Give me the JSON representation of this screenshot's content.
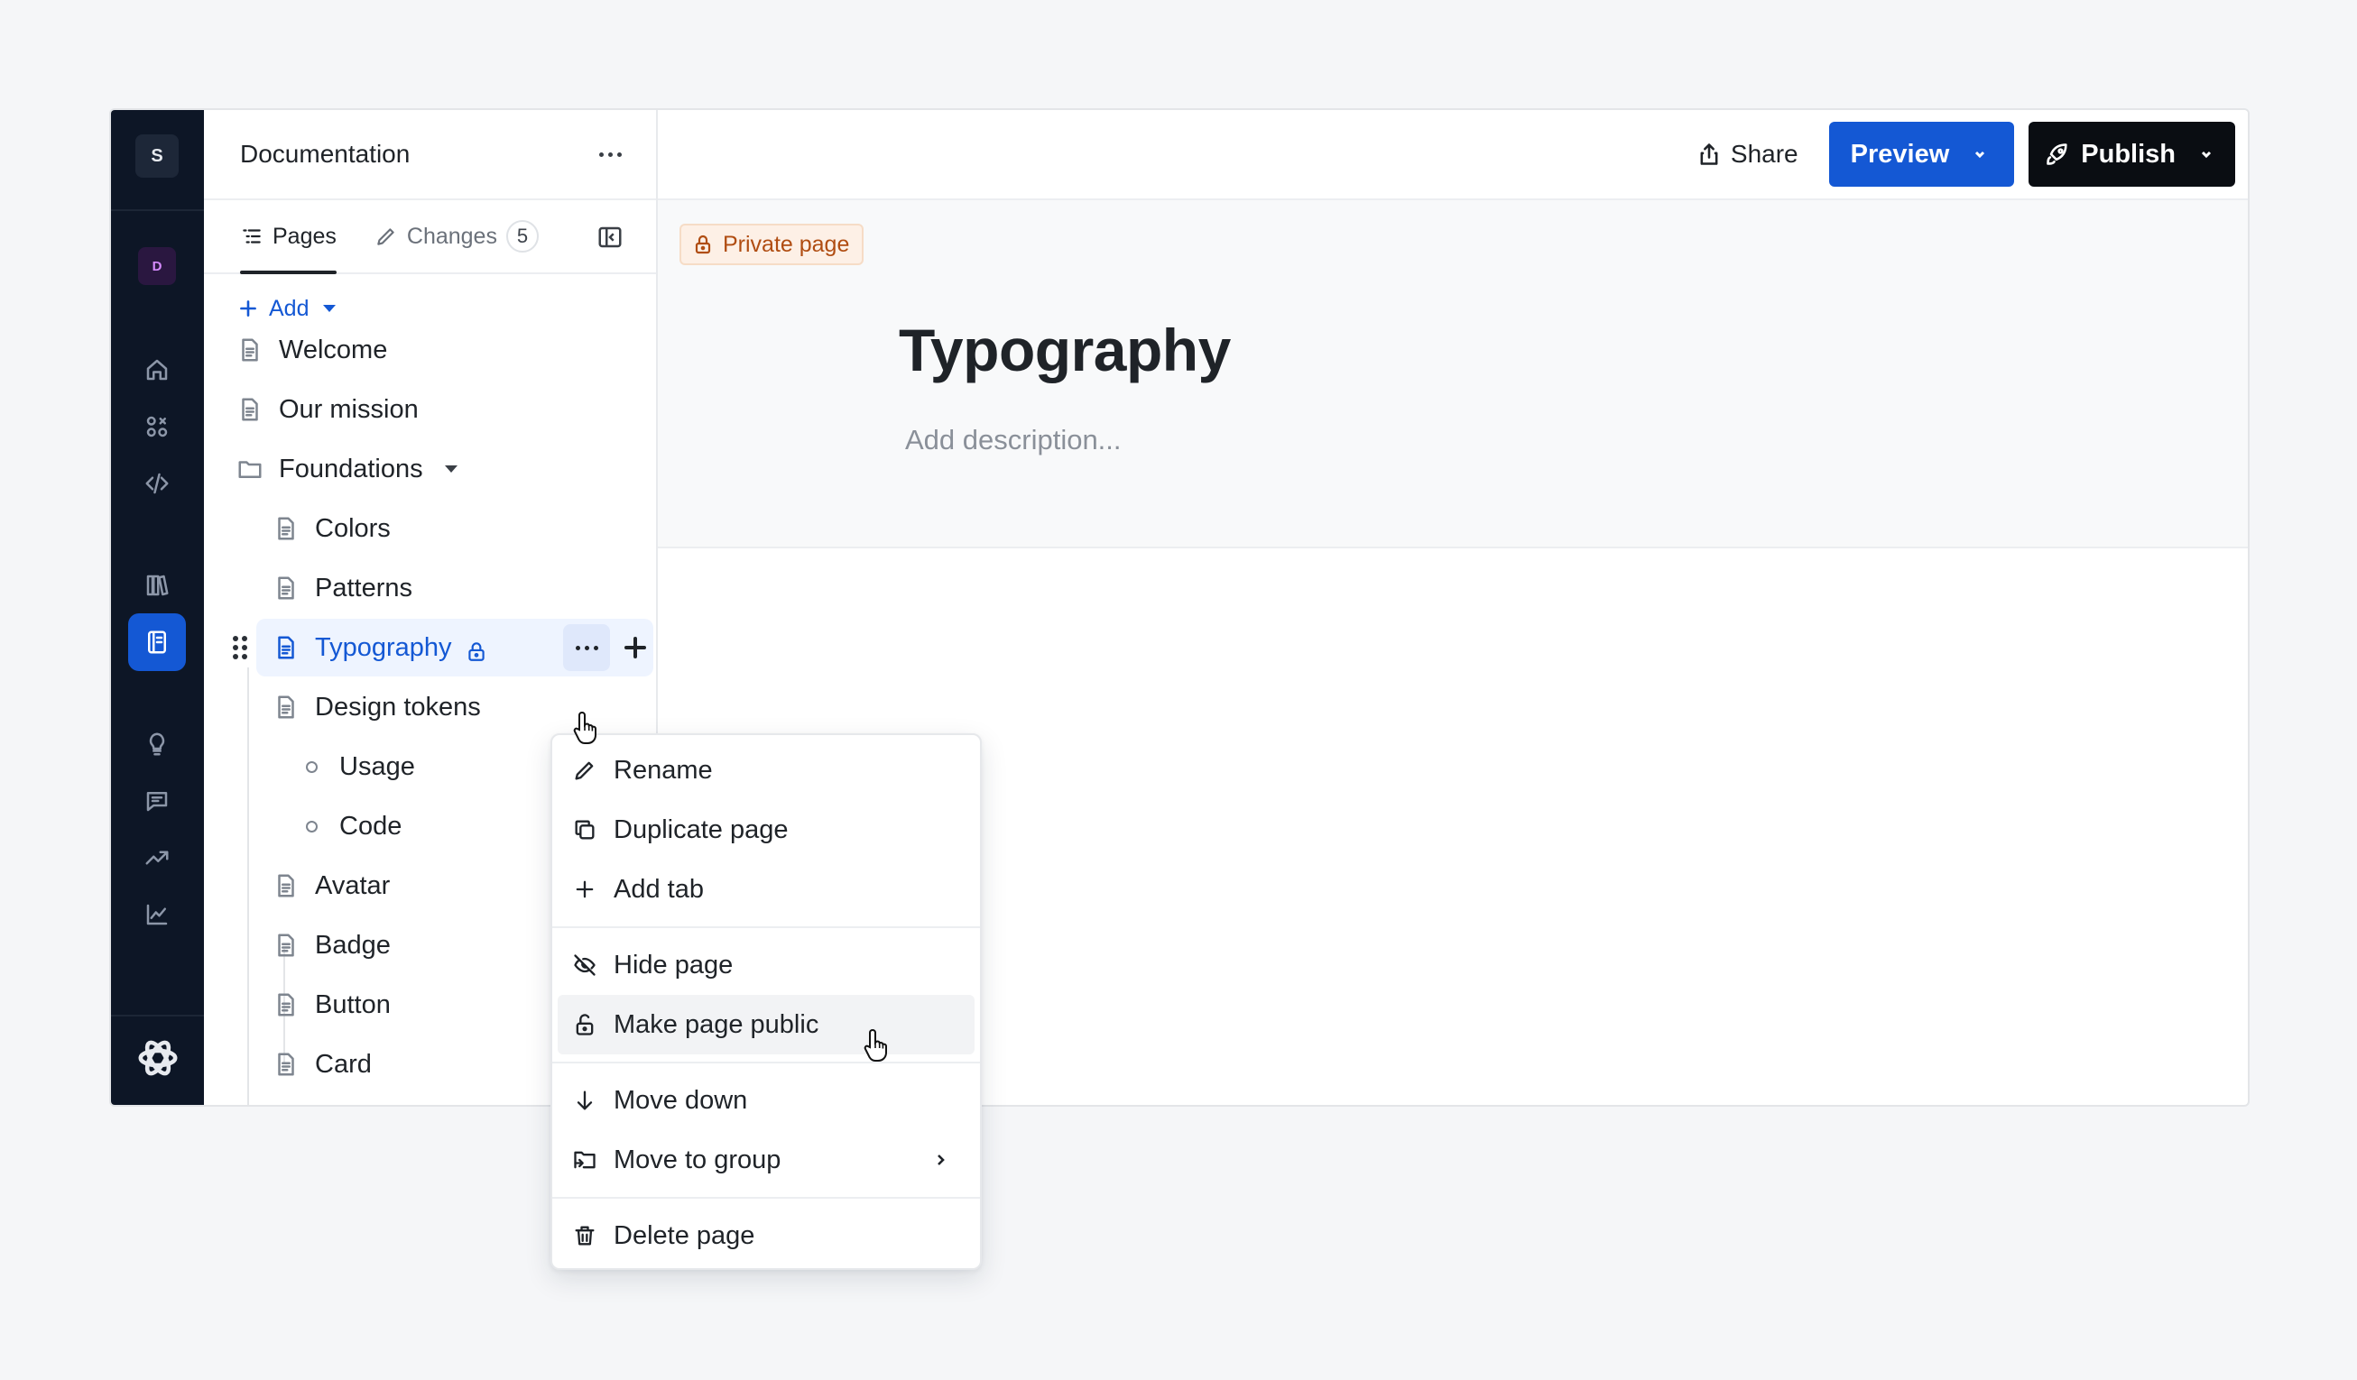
{
  "rail": {
    "workspace_initial": "S",
    "project_initial": "D",
    "items": [
      "home-icon",
      "components-icon",
      "code-icon",
      "library-icon",
      "documentation-icon",
      "lightbulb-icon",
      "feedback-icon",
      "trending-icon",
      "analytics-icon"
    ],
    "active": "documentation-icon"
  },
  "sidebar": {
    "title": "Documentation",
    "tabs": [
      {
        "label": "Pages",
        "icon": "list-icon",
        "active": true
      },
      {
        "label": "Changes",
        "icon": "pencil-icon",
        "count": "5"
      }
    ],
    "add_label": "Add",
    "tree": [
      {
        "label": "Welcome",
        "type": "page"
      },
      {
        "label": "Our mission",
        "type": "page"
      },
      {
        "label": "Foundations",
        "type": "folder"
      },
      {
        "label": "Colors",
        "type": "page"
      },
      {
        "label": "Patterns",
        "type": "page"
      },
      {
        "label": "Typography",
        "type": "page",
        "selected": true,
        "locked": true
      },
      {
        "label": "Design tokens",
        "type": "page"
      },
      {
        "label": "Usage",
        "type": "tab"
      },
      {
        "label": "Code",
        "type": "tab"
      },
      {
        "label": "Avatar",
        "type": "page"
      },
      {
        "label": "Badge",
        "type": "page"
      },
      {
        "label": "Button",
        "type": "page"
      },
      {
        "label": "Card",
        "type": "page"
      }
    ]
  },
  "toolbar": {
    "share_label": "Share",
    "preview_label": "Preview",
    "publish_label": "Publish"
  },
  "page": {
    "visibility_badge": "Private page",
    "title": "Typography",
    "description_placeholder": "Add description..."
  },
  "context_menu": {
    "items": [
      {
        "label": "Rename",
        "icon": "pencil-icon"
      },
      {
        "label": "Duplicate page",
        "icon": "duplicate-icon"
      },
      {
        "label": "Add tab",
        "icon": "plus-icon"
      },
      {
        "label": "Hide page",
        "icon": "eye-off-icon"
      },
      {
        "label": "Make page public",
        "icon": "unlock-icon",
        "hovered": true
      },
      {
        "label": "Move down",
        "icon": "arrow-down-icon"
      },
      {
        "label": "Move to group",
        "icon": "folder-move-icon",
        "submenu": true
      },
      {
        "label": "Delete page",
        "icon": "trash-icon"
      }
    ]
  },
  "colors": {
    "accent": "#1458d4",
    "rail_bg": "#0d1626",
    "private_badge": "#b04d12"
  }
}
